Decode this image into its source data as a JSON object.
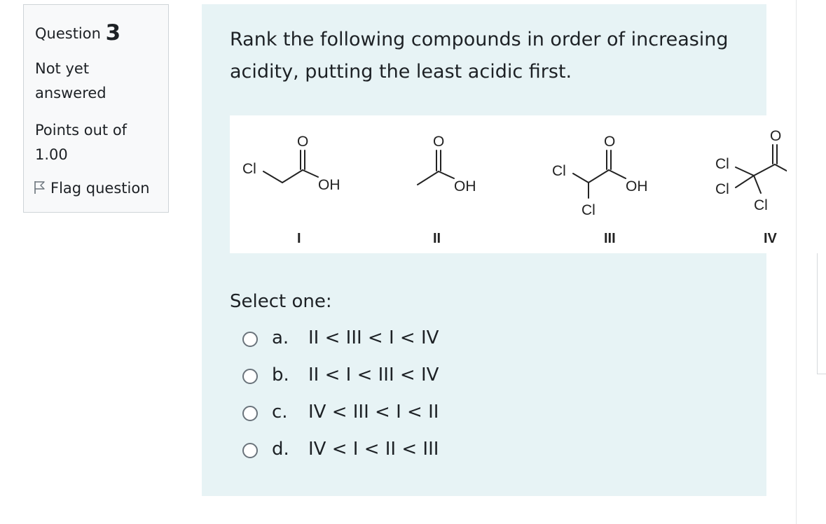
{
  "info": {
    "question_label": "Question",
    "question_number": "3",
    "state": "Not yet answered",
    "grade": "Points out of 1.00",
    "flag_label": "Flag question"
  },
  "question": {
    "text": "Rank the following compounds in order of increasing acidity, putting the least acidic first.",
    "prompt": "Select one:"
  },
  "structures": {
    "oxygen": "O",
    "hydroxyl": "OH",
    "chlorine": "Cl",
    "labels": [
      "I",
      "II",
      "III",
      "IV"
    ]
  },
  "answers": [
    {
      "letter": "a.",
      "text": "II < III < I < IV"
    },
    {
      "letter": "b.",
      "text": "II < I < III < IV"
    },
    {
      "letter": "c.",
      "text": "IV < III < I < II"
    },
    {
      "letter": "d.",
      "text": "IV < I < II < III"
    }
  ]
}
